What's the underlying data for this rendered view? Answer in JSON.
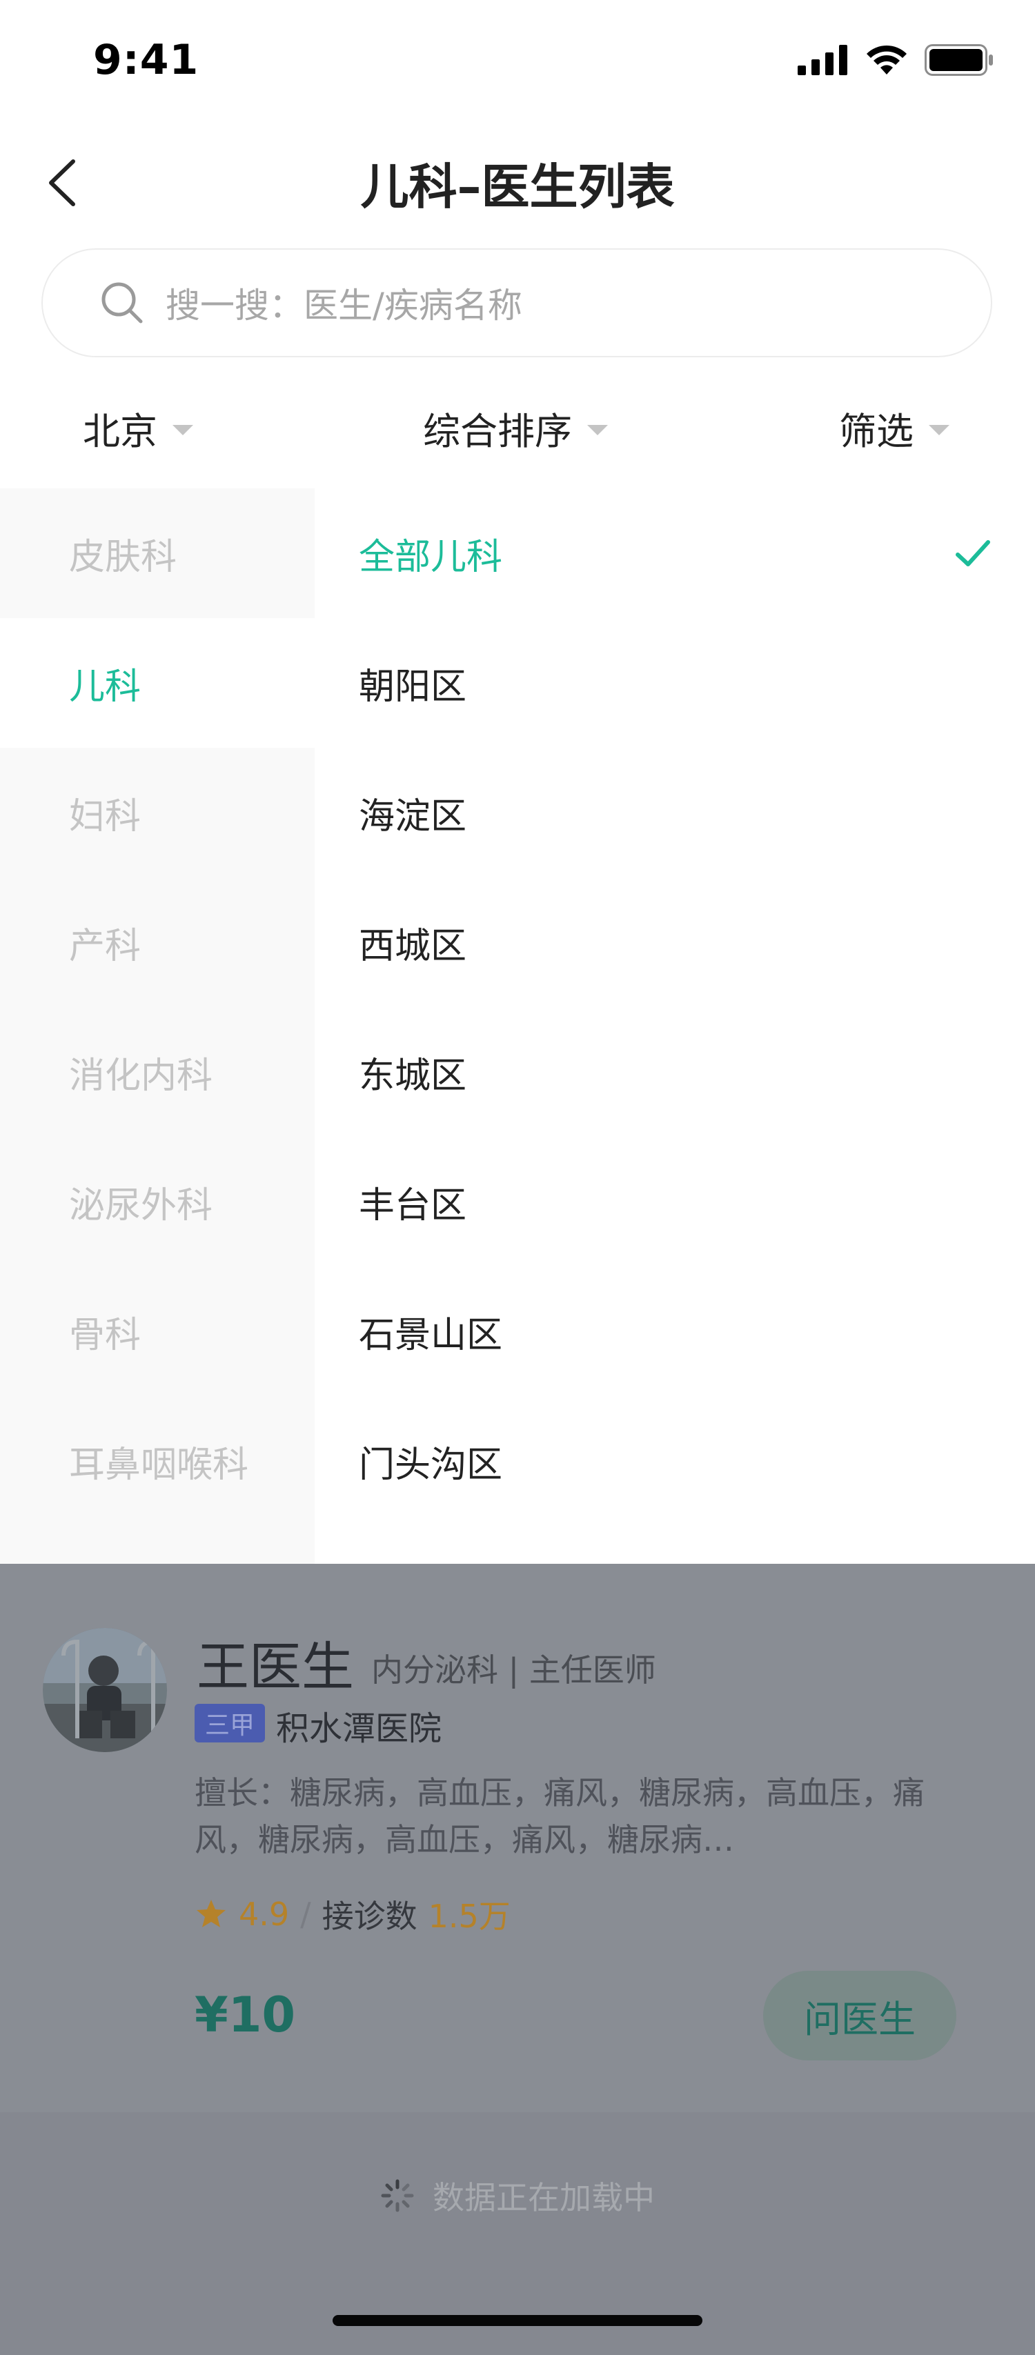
{
  "status": {
    "time": "9:41"
  },
  "nav": {
    "title": "儿科–医生列表"
  },
  "search": {
    "placeholder": "搜一搜：医生/疾病名称"
  },
  "filters": {
    "city": "北京",
    "sort": "综合排序",
    "filter": "筛选"
  },
  "categories": [
    {
      "label": "皮肤科"
    },
    {
      "label": "儿科",
      "active": true
    },
    {
      "label": "妇科"
    },
    {
      "label": "产科"
    },
    {
      "label": "消化内科"
    },
    {
      "label": "泌尿外科"
    },
    {
      "label": "骨科"
    },
    {
      "label": "耳鼻咽喉科"
    }
  ],
  "districts": [
    {
      "label": "全部儿科",
      "selected": true
    },
    {
      "label": "朝阳区"
    },
    {
      "label": "海淀区"
    },
    {
      "label": "西城区"
    },
    {
      "label": "东城区"
    },
    {
      "label": "丰台区"
    },
    {
      "label": "石景山区"
    },
    {
      "label": "门头沟区"
    }
  ],
  "doctor": {
    "name": "王医生",
    "dept": "内分泌科 | 主任医师",
    "badge": "三甲",
    "hospital": "积水潭医院",
    "desc": "擅长：糖尿病，高血压，痛风，糖尿病，高血压，痛风，糖尿病，高血压，痛风，糖尿病…",
    "rating": "4.9",
    "sep": "/",
    "consult_label": "接诊数",
    "consult_count": "1.5万",
    "price": "¥10",
    "ask_label": "问医生"
  },
  "loading": {
    "text": "数据正在加载中"
  },
  "colors": {
    "accent": "#1cbc99",
    "overlay": "#898d94",
    "rating": "#b5822a"
  },
  "icons": [
    "back-arrow-icon",
    "search-icon",
    "check-icon",
    "star-icon",
    "spinner-icon",
    "signal-icon",
    "wifi-icon",
    "battery-icon"
  ]
}
